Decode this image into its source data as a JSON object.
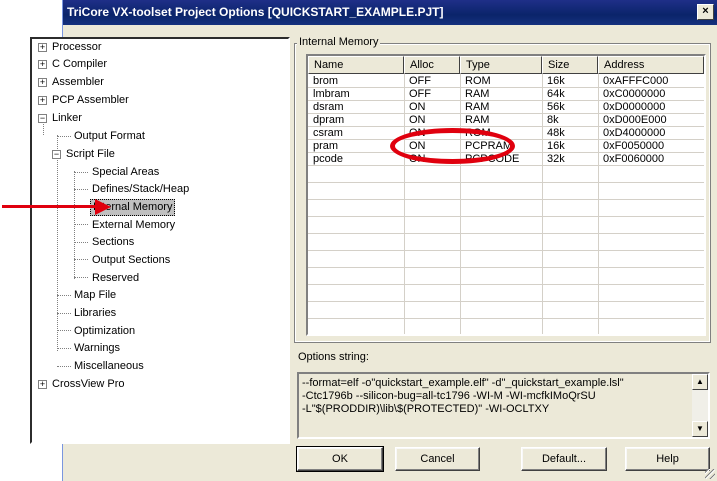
{
  "window": {
    "title": "TriCore VX-toolset Project Options [QUICKSTART_EXAMPLE.PJT]",
    "close_label": "×"
  },
  "tree": {
    "items": [
      {
        "label": "Processor",
        "expander": "+"
      },
      {
        "label": "C Compiler",
        "expander": "+"
      },
      {
        "label": "Assembler",
        "expander": "+"
      },
      {
        "label": "PCP Assembler",
        "expander": "+"
      },
      {
        "label": "Linker",
        "expander": "−"
      },
      {
        "label": "Output Format"
      },
      {
        "label": "Script File",
        "expander": "−"
      },
      {
        "label": "Special Areas"
      },
      {
        "label": "Defines/Stack/Heap"
      },
      {
        "label": "Internal Memory",
        "selected": true
      },
      {
        "label": "External Memory"
      },
      {
        "label": "Sections"
      },
      {
        "label": "Output Sections"
      },
      {
        "label": "Reserved"
      },
      {
        "label": "Map File"
      },
      {
        "label": "Libraries"
      },
      {
        "label": "Optimization"
      },
      {
        "label": "Warnings"
      },
      {
        "label": "Miscellaneous"
      },
      {
        "label": "CrossView Pro",
        "expander": "+"
      }
    ]
  },
  "internal_memory": {
    "group_title": "Internal Memory",
    "columns": [
      "Name",
      "Alloc",
      "Type",
      "Size",
      "Address"
    ],
    "rows": [
      [
        "brom",
        "OFF",
        "ROM",
        "16k",
        "0xAFFFC000"
      ],
      [
        "lmbram",
        "OFF",
        "RAM",
        "64k",
        "0xC0000000"
      ],
      [
        "dsram",
        "ON",
        "RAM",
        "56k",
        "0xD0000000"
      ],
      [
        "dpram",
        "ON",
        "RAM",
        "8k",
        "0xD000E000"
      ],
      [
        "csram",
        "ON",
        "ROM",
        "48k",
        "0xD4000000"
      ],
      [
        "pram",
        "ON",
        "PCPRAM",
        "16k",
        "0xF0050000"
      ],
      [
        "pcode",
        "ON",
        "PCPCODE",
        "32k",
        "0xF0060000"
      ]
    ]
  },
  "options": {
    "label": "Options string:",
    "lines": [
      "--format=elf -o\"quickstart_example.elf\" -d\"_quickstart_example.lsl\"",
      "-Ctc1796b --silicon-bug=all-tc1796 -WI-M -WI-mcfkIMoQrSU",
      "-L\"$(PRODDIR)\\lib\\$(PROTECTED)\" -WI-OCLTXY"
    ],
    "scroll_up": "▲",
    "scroll_down": "▼"
  },
  "buttons": {
    "ok": "OK",
    "cancel": "Cancel",
    "default": "Default...",
    "help": "Help"
  },
  "colors": {
    "annotation": "#e0000e",
    "titlebar": "#0a246a"
  }
}
